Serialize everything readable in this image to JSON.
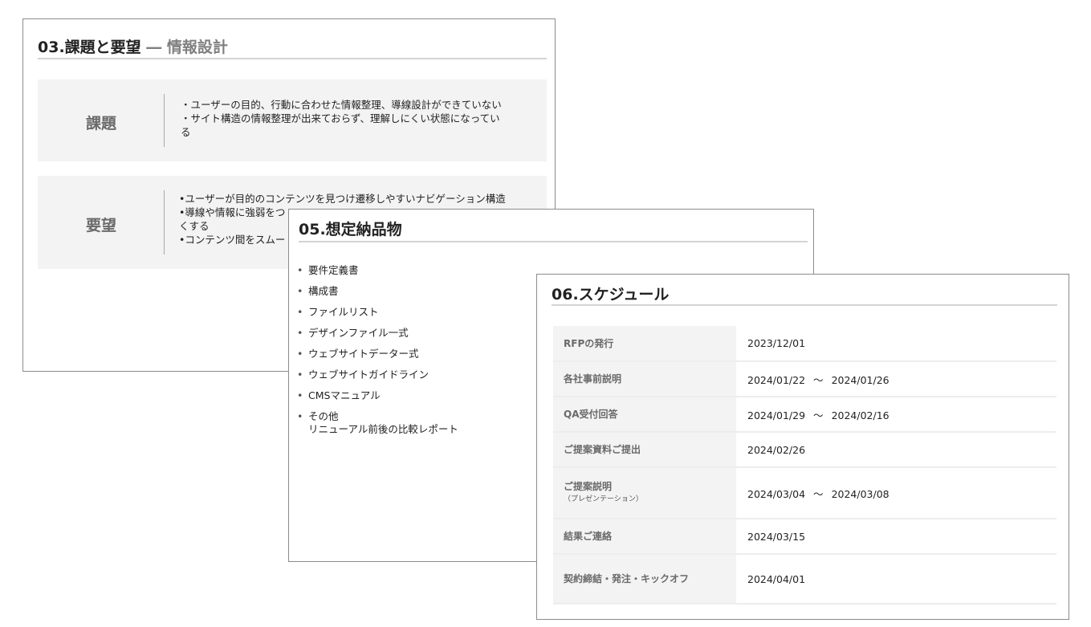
{
  "card03": {
    "title_main": "03.課題と要望",
    "title_sub": " ― 情報設計",
    "issues": {
      "heading": "課題",
      "lines": [
        "・ユーザーの目的、行動に合わせた情報整理、導線設計ができていない",
        "・サイト構造の情報整理が出来ておらず、理解しにくい状態になってい",
        "る"
      ]
    },
    "requests": {
      "heading": "要望",
      "lines": [
        "•ユーザーが目的のコンテンツを見つけ遷移しやすいナビゲーション構造",
        "•導線や情報に強弱をつ",
        "くする",
        "•コンテンツ間をスムー"
      ]
    }
  },
  "card05": {
    "title": "05.想定納品物",
    "bullet": "•",
    "items": [
      {
        "label": "要件定義書"
      },
      {
        "label": "構成書"
      },
      {
        "label": "ファイルリスト"
      },
      {
        "label": "デザインファイル一式"
      },
      {
        "label": "ウェブサイトデーター式"
      },
      {
        "label": "ウェブサイトガイドライン"
      },
      {
        "label": "CMSマニュアル"
      },
      {
        "label": "その他",
        "sub": "リニューアル前後の比較レポート"
      }
    ]
  },
  "card06": {
    "title": "06.スケジュール",
    "tilde": "～",
    "rows": [
      {
        "label": "RFPの発行",
        "note": "",
        "start": "2023/12/01",
        "end": ""
      },
      {
        "label": "各社事前説明",
        "note": "",
        "start": "2024/01/22",
        "end": "2024/01/26"
      },
      {
        "label": "QA受付回答",
        "note": "",
        "start": "2024/01/29",
        "end": "2024/02/16"
      },
      {
        "label": "ご提案資料ご提出",
        "note": "",
        "start": "2024/02/26",
        "end": ""
      },
      {
        "label": "ご提案説明",
        "note": "（プレゼンテーション）",
        "start": "2024/03/04",
        "end": "2024/03/08"
      },
      {
        "label": "結果ご連絡",
        "note": "",
        "start": "2024/03/15",
        "end": ""
      },
      {
        "label": "契約締結・発注・キックオフ",
        "note": "",
        "start": "2024/04/01",
        "end": ""
      }
    ]
  }
}
